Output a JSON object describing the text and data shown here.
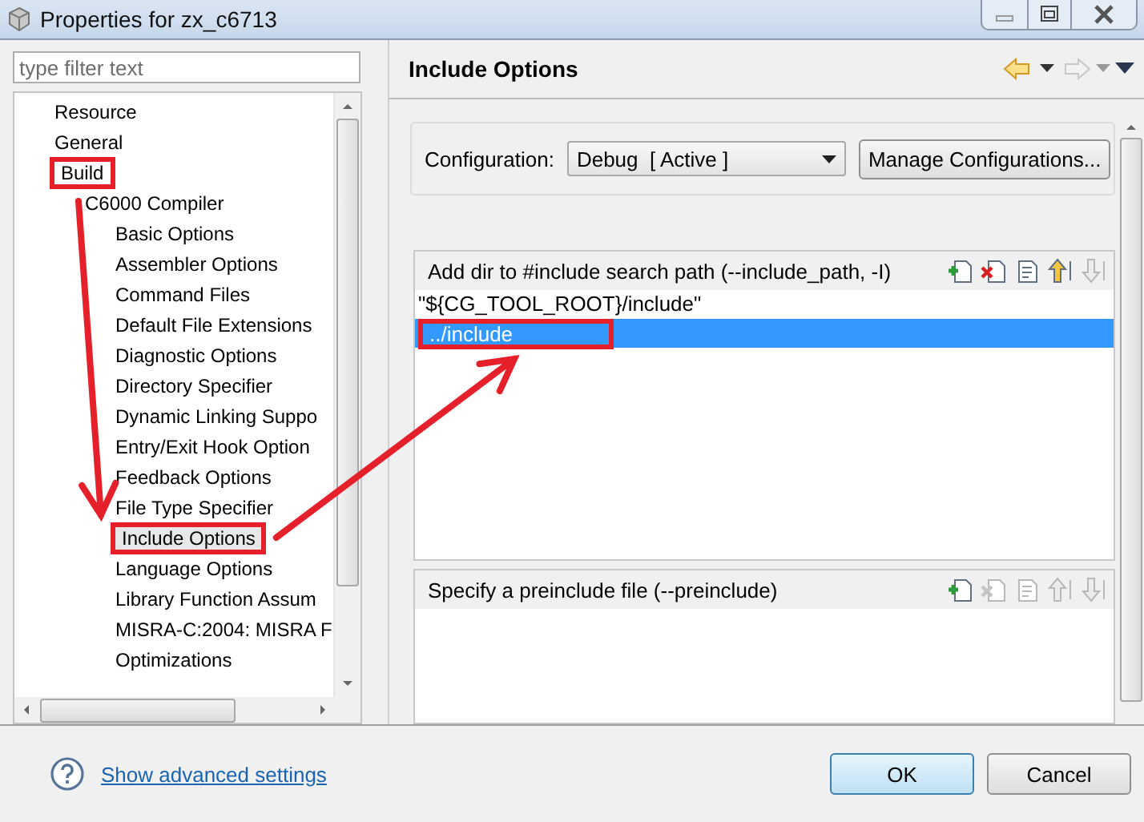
{
  "window": {
    "title": "Properties for zx_c6713"
  },
  "filter": {
    "placeholder": "type filter text"
  },
  "tree": [
    {
      "label": "Resource",
      "selected": false,
      "marked": false
    },
    {
      "label": "General",
      "selected": false,
      "marked": false
    },
    {
      "label": "Build",
      "selected": false,
      "marked": true,
      "children": [
        {
          "label": "C6000 Compiler",
          "selected": false,
          "marked": false,
          "children": [
            {
              "label": "Basic Options",
              "selected": false,
              "marked": false
            },
            {
              "label": "Assembler Options",
              "selected": false,
              "marked": false
            },
            {
              "label": "Command Files",
              "selected": false,
              "marked": false
            },
            {
              "label": "Default File Extensions",
              "selected": false,
              "marked": false
            },
            {
              "label": "Diagnostic Options",
              "selected": false,
              "marked": false
            },
            {
              "label": "Directory Specifier",
              "selected": false,
              "marked": false
            },
            {
              "label": "Dynamic Linking Suppo",
              "selected": false,
              "marked": false
            },
            {
              "label": "Entry/Exit Hook Option",
              "selected": false,
              "marked": false
            },
            {
              "label": "Feedback Options",
              "selected": false,
              "marked": false
            },
            {
              "label": "File Type Specifier",
              "selected": false,
              "marked": false
            },
            {
              "label": "Include Options",
              "selected": true,
              "marked": true
            },
            {
              "label": "Language Options",
              "selected": false,
              "marked": false
            },
            {
              "label": "Library Function Assum",
              "selected": false,
              "marked": false
            },
            {
              "label": "MISRA-C:2004: MISRA F",
              "selected": false,
              "marked": false
            },
            {
              "label": "Optimizations",
              "selected": false,
              "marked": false
            }
          ]
        }
      ]
    }
  ],
  "page": {
    "title": "Include Options",
    "back": {
      "disabled": false
    },
    "forward": {
      "disabled": true
    }
  },
  "configuration": {
    "label": "Configuration:",
    "value": "Debug  [ Active ]",
    "button": "Manage Configurations..."
  },
  "lists": [
    {
      "title": "Add dir to #include search path (--include_path, -I)",
      "tools": [
        {
          "kind": "add",
          "disabled": false
        },
        {
          "kind": "delete",
          "disabled": false
        },
        {
          "kind": "edit",
          "disabled": false
        },
        {
          "kind": "up",
          "disabled": false
        },
        {
          "kind": "down",
          "disabled": true
        }
      ],
      "items": [
        {
          "text": "\"${CG_TOOL_ROOT}/include\"",
          "selected": false,
          "marked": false
        },
        {
          "text": "../include",
          "selected": true,
          "marked": true
        }
      ]
    },
    {
      "title": "Specify a preinclude file (--preinclude)",
      "tools": [
        {
          "kind": "add",
          "disabled": false
        },
        {
          "kind": "delete",
          "disabled": true
        },
        {
          "kind": "edit",
          "disabled": true
        },
        {
          "kind": "up",
          "disabled": true
        },
        {
          "kind": "down",
          "disabled": true
        }
      ]
    }
  ],
  "footer": {
    "link": "Show advanced settings",
    "buttons": [
      {
        "label": "OK",
        "kind": "default"
      },
      {
        "label": "Cancel",
        "kind": "normal"
      }
    ]
  }
}
